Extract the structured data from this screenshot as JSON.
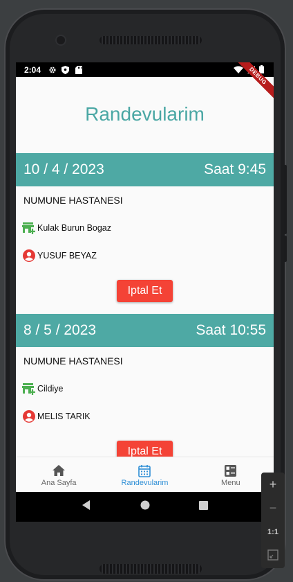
{
  "status_bar": {
    "time": "2:04",
    "debug_banner": "DEBUG"
  },
  "page_title": "Randevularim",
  "appointments": [
    {
      "date": "10 / 4 / 2023",
      "time": "Saat 9:45",
      "hospital": "NUMUNE HASTANESI",
      "department": "Kulak Burun Bogaz",
      "doctor": "YUSUF BEYAZ",
      "cancel_label": "Iptal Et"
    },
    {
      "date": "8 / 5 / 2023",
      "time": "Saat 10:55",
      "hospital": "NUMUNE HASTANESI",
      "department": "Cildiye",
      "doctor": "MELIS TARIK",
      "cancel_label": "Iptal Et"
    }
  ],
  "bottom_nav": {
    "items": [
      {
        "label": "Ana Sayfa",
        "icon": "home-icon"
      },
      {
        "label": "Randevularim",
        "icon": "calendar-icon",
        "active": true
      },
      {
        "label": "Menu",
        "icon": "menu-grid-icon"
      }
    ]
  },
  "emulator_toolbar": {
    "zoom_in": "+",
    "zoom_out": "−",
    "one_to_one": "1:1"
  },
  "colors": {
    "teal": "#4ea9a4",
    "title_teal": "#4aa7a4",
    "cancel_red": "#f44336",
    "department_green": "#4caf50",
    "doctor_red": "#e53935",
    "nav_active_blue": "#2f8fd6"
  }
}
